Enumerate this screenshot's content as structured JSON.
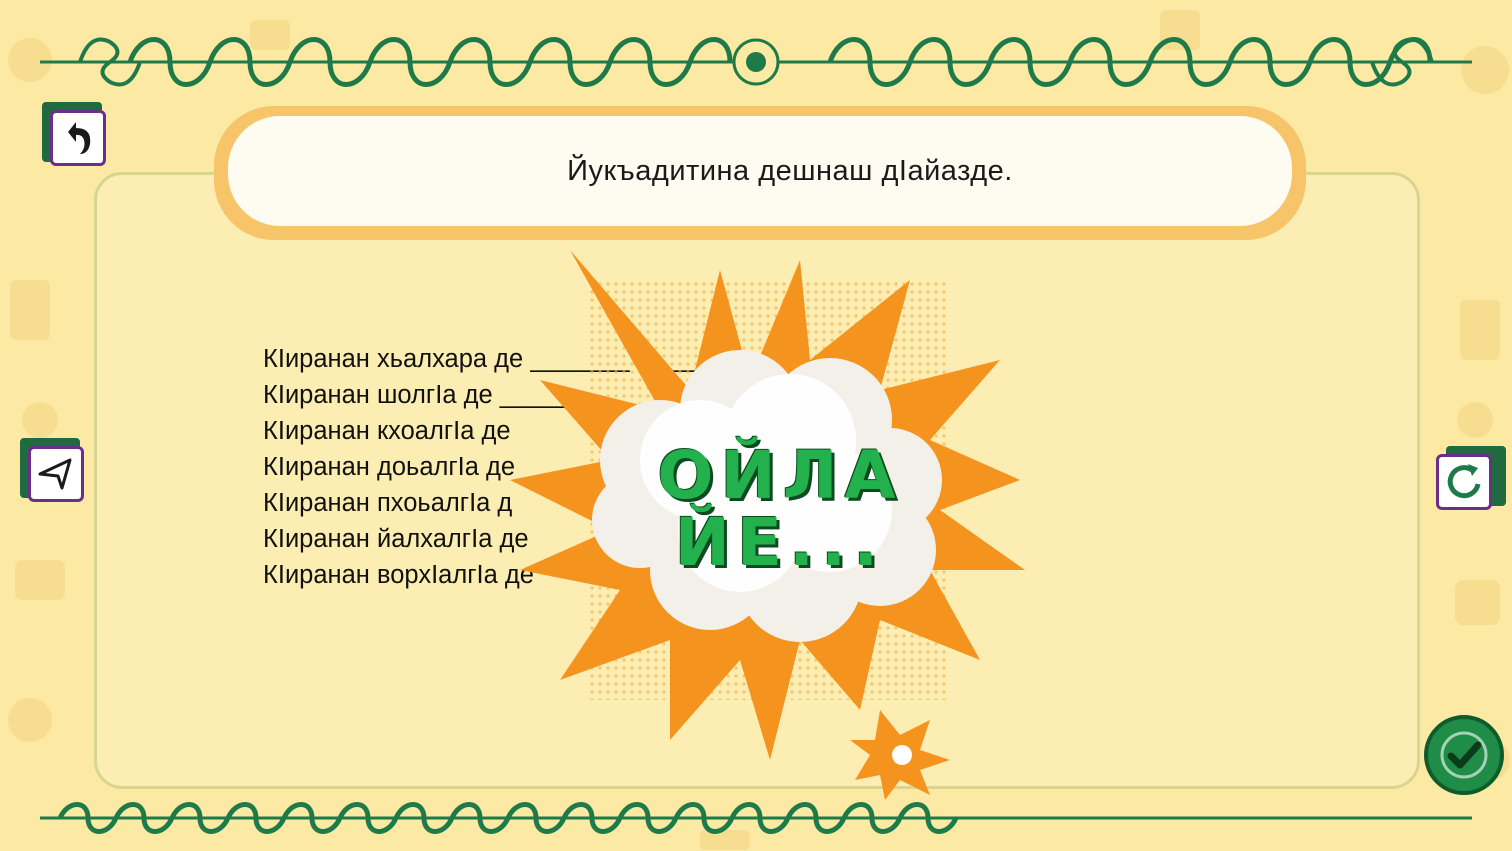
{
  "task": {
    "instruction": "Йукъадитина дешнаш дӀайазде."
  },
  "sentences": [
    "КIиранан хьалхара де _______      ____ди",
    "КIиранан шолгIа де _____",
    "КIиранан кхоалгIа де",
    "КIиранан доьалгIа де _",
    "КIиранан пхоьалгIа д",
    "КIиранан йалхалгIа де",
    "КIиранан ворхIалгIа де"
  ],
  "feedback": {
    "line1": "ОЙЛА",
    "line2": "ЙЕ..."
  },
  "buttons": {
    "back": "back-arrow-icon",
    "prev": "prev-triangle-icon",
    "restart": "restart-icon",
    "check": "check-icon"
  },
  "colors": {
    "background": "#fbe9a4",
    "panel": "#fcedb2",
    "ornament": "#1f7a4a",
    "burst": "#f5931f",
    "feedback_text": "#22b14c",
    "button_border": "#6a2f8a"
  }
}
